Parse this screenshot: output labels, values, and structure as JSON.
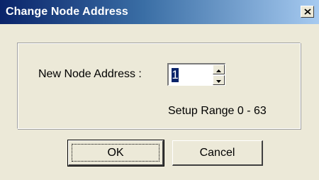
{
  "window": {
    "title": "Change Node Address",
    "close_icon": "close-icon"
  },
  "form": {
    "address_label": "New Node Address :",
    "address_value": "1",
    "spinner_up_icon": "triangle-up-icon",
    "spinner_down_icon": "triangle-down-icon",
    "range_text": "Setup Range 0 - 63"
  },
  "buttons": {
    "ok_label": "OK",
    "cancel_label": "Cancel"
  },
  "colors": {
    "title_bar_start": "#0a246a",
    "title_bar_end": "#a6caf0",
    "dialog_face": "#ece9d8",
    "selection": "#0a246a"
  }
}
